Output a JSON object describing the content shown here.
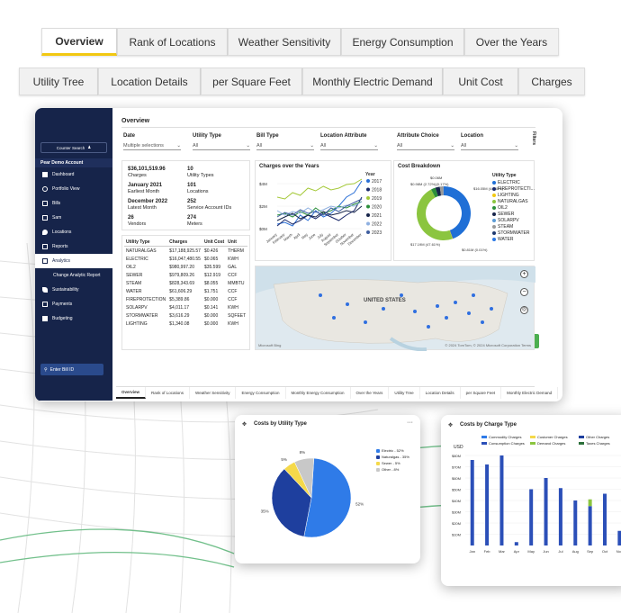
{
  "top_tabs": [
    "Overview",
    "Rank of Locations",
    "Weather Sensitivity",
    "Energy Consumption",
    "Over the Years"
  ],
  "second_tabs": [
    "Utility Tree",
    "Location Details",
    "per Square Feet",
    "Monthly Electric Demand",
    "Unit Cost",
    "Charges"
  ],
  "sidebar": {
    "search_label": "Counter Search",
    "org": "Pear Demo Account",
    "items": [
      "Dashboard",
      "Portfolio View",
      "Bills",
      "Sam",
      "Locations",
      "Reports",
      "Analytics",
      "Change Analytic Report",
      "Sustainability",
      "Payments",
      "Budgeting"
    ],
    "bill_search": "Enter Bill ID"
  },
  "report": {
    "title": "Overview",
    "filters_label": "Filters",
    "filters": [
      {
        "label": "Date",
        "value": "Multiple selections"
      },
      {
        "label": "Utility Type",
        "value": "All"
      },
      {
        "label": "Bill Type",
        "value": "All"
      },
      {
        "label": "Location Attribute",
        "value": "All"
      },
      {
        "label": "Attribute Choice",
        "value": "All"
      },
      {
        "label": "Location",
        "value": "All"
      }
    ],
    "kpis": [
      {
        "value": "$36,101,519.96",
        "label": "Charges"
      },
      {
        "value": "10",
        "label": "Utility Types"
      },
      {
        "value": "January 2021",
        "label": "Earliest Month"
      },
      {
        "value": "101",
        "label": "Locations"
      },
      {
        "value": "December 2022",
        "label": "Latest Month"
      },
      {
        "value": "252",
        "label": "Service Account IDs"
      },
      {
        "value": "26",
        "label": "Vendors"
      },
      {
        "value": "274",
        "label": "Meters"
      }
    ],
    "table_headers": [
      "Utility Type",
      "Charges",
      "Unit Cost",
      "Unit"
    ],
    "table_rows": [
      [
        "NATURALGAS",
        "$17,188,925.57",
        "$0.426",
        "THERM"
      ],
      [
        "ELECTRIC",
        "$16,047,480.55",
        "$0.065",
        "KWH"
      ],
      [
        "OIL2",
        "$980,997.20",
        "$35.599",
        "GAL"
      ],
      [
        "SEWER",
        "$979,809.26",
        "$12.919",
        "CCF"
      ],
      [
        "STEAM",
        "$828,343.69",
        "$8.055",
        "MMBTU"
      ],
      [
        "WATER",
        "$61,606.29",
        "$1.751",
        "CCF"
      ],
      [
        "FIREPROTECTION",
        "$5,389.86",
        "$0.000",
        "CCF"
      ],
      [
        "SOLARPV",
        "$4,011.17",
        "$0.141",
        "KWH"
      ],
      [
        "STORMWATER",
        "$3,616.29",
        "$0.000",
        "SQFEET"
      ],
      [
        "LIGHTING",
        "$1,340.08",
        "$0.000",
        "KWH"
      ]
    ],
    "charges_title": "Charges over the Years",
    "year_legend_title": "Year",
    "years": [
      "2017",
      "2018",
      "2019",
      "2020",
      "2021",
      "2022",
      "2023"
    ],
    "year_colors": [
      "#2a6fd6",
      "#1b2a6b",
      "#a5c93a",
      "#2b8f3a",
      "#16244a",
      "#8fb0e0",
      "#3f5e9f"
    ],
    "months": [
      "January",
      "February",
      "March",
      "April",
      "May",
      "June",
      "July",
      "August",
      "September",
      "October",
      "November",
      "December"
    ],
    "yticks": [
      "$4M",
      "$2M",
      "$0M"
    ],
    "breakdown_title": "Cost Breakdown",
    "breakdown_legend_title": "Utility Type",
    "breakdown_items": [
      "ELECTRIC",
      "FIREPROTECTI...",
      "LIGHTING",
      "NATURALGAS",
      "OIL2",
      "SEWER",
      "SOLARPV",
      "STEAM",
      "STORMWATER",
      "WATER"
    ],
    "breakdown_colors": [
      "#1f6fd6",
      "#1b2a6b",
      "#f2c811",
      "#8bc53f",
      "#2b8f3a",
      "#16244a",
      "#5b9bd5",
      "#999999",
      "#1f3a70",
      "#2b78e4"
    ],
    "donut_labels": [
      "$0.06M",
      "$0.98M (2.72%)(0.17%)",
      "$16.05M (44.45%)",
      "$17.19M (47.61%)",
      "$0.81M (0.01%)",
      "$0.00M (0%)"
    ],
    "map_label": "UNITED STATES",
    "map_credit": "© 2024 TomTom, © 2024 Microsoft Corporation Terms",
    "map_logo": "Microsoft Bing",
    "bottom_tabs": [
      "Overview",
      "Rank of Locations",
      "Weather Sensitivity",
      "Energy Consumption",
      "Monthly Energy Consumption",
      "Over the Years",
      "Utility Tree",
      "Location Details",
      "per Square Feet",
      "Monthly Electric Demand",
      "Unit"
    ]
  },
  "pie_card": {
    "title": "Costs by Utility Type",
    "legend": [
      "Electric - 52%",
      "Naturalgas - 35%",
      "Sewer - 5%",
      "Other - 8%"
    ],
    "labels": [
      "52%",
      "35%",
      "5%",
      "8%"
    ],
    "colors": [
      "#2f7be8",
      "#1e3f9e",
      "#f5d94a",
      "#c8c8c8"
    ]
  },
  "bar_card": {
    "title": "Costs by Charge Type",
    "legend": [
      "Commodity Charges",
      "Customer Charges",
      "Other Charges",
      "Consumption Charges",
      "Demand Charges",
      "Taxes Charges"
    ],
    "legend_colors": [
      "#2f7be8",
      "#f5d94a",
      "#1e3f9e",
      "#2b4fb8",
      "#8bc53f",
      "#2b6f3a"
    ],
    "unit": "USD",
    "yticks": [
      "$80M",
      "$70M",
      "$60M",
      "$50M",
      "$40M",
      "$30M",
      "$20M",
      "$10M"
    ],
    "months": [
      "Jan",
      "Feb",
      "Mar",
      "Apr",
      "May",
      "Jun",
      "Jul",
      "Aug",
      "Sep",
      "Oct",
      "Nov"
    ]
  },
  "chart_data": [
    {
      "type": "pie",
      "title": "Costs by Utility Type",
      "categories": [
        "Electric",
        "Naturalgas",
        "Sewer",
        "Other"
      ],
      "values": [
        52,
        35,
        5,
        8
      ]
    },
    {
      "type": "bar",
      "title": "Costs by Charge Type",
      "categories": [
        "Jan",
        "Feb",
        "Mar",
        "Apr",
        "May",
        "Jun",
        "Jul",
        "Aug",
        "Sep",
        "Oct",
        "Nov"
      ],
      "series": [
        {
          "name": "Consumption Charges",
          "values": [
            76,
            72,
            80,
            3,
            50,
            60,
            51,
            40,
            35,
            46,
            13
          ]
        },
        {
          "name": "Demand Charges",
          "values": [
            0,
            0,
            0,
            0,
            0,
            0,
            0,
            0,
            6,
            0,
            0
          ]
        }
      ],
      "ylim": [
        0,
        80
      ]
    }
  ]
}
